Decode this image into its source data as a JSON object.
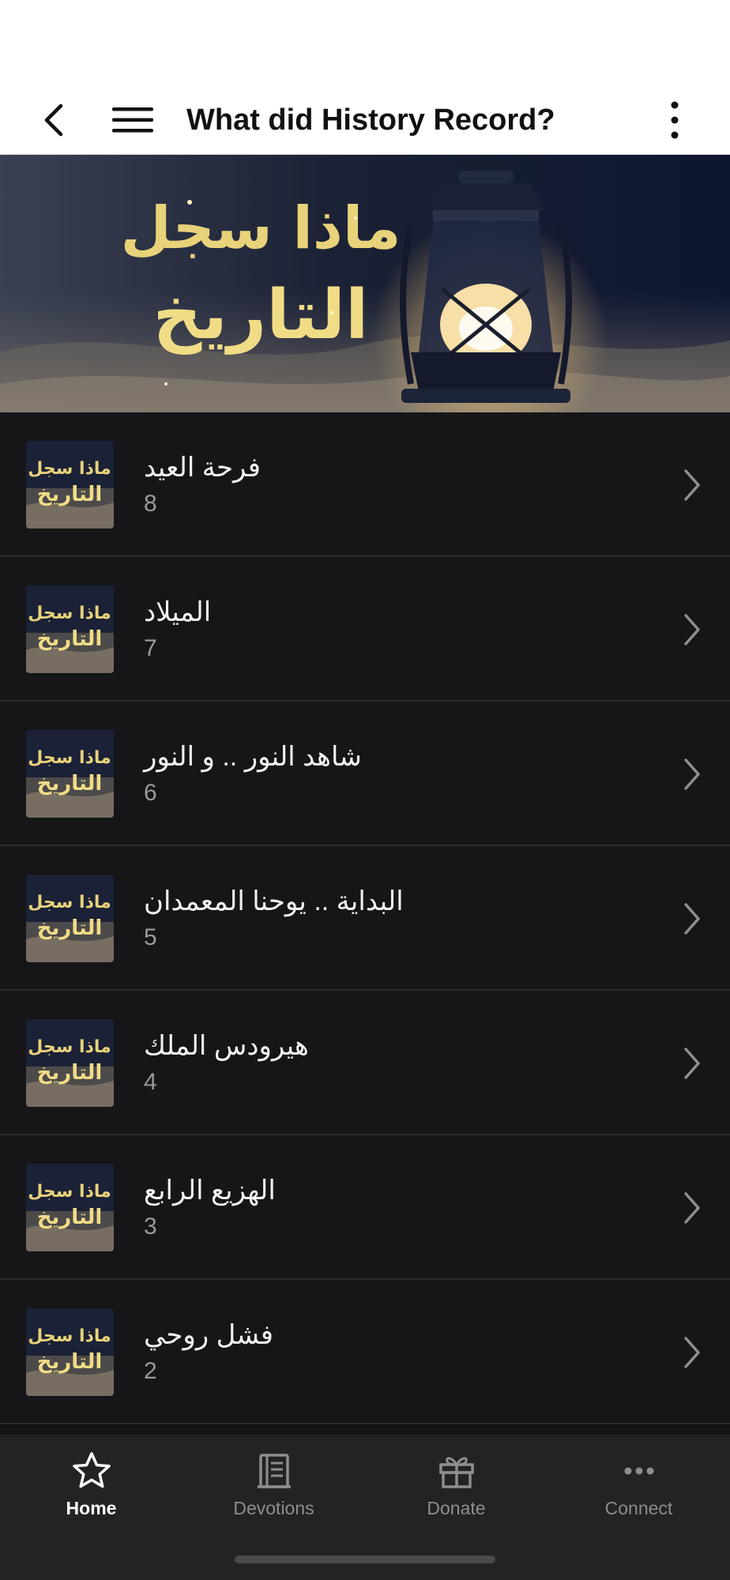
{
  "header": {
    "title": "What did History Record?",
    "back_icon": "chevron-left-icon",
    "menu_icon": "hamburger-menu-icon",
    "more_icon": "more-vertical-icon"
  },
  "banner": {
    "artwork_text": "ماذا سجل التاريخ"
  },
  "episodes": [
    {
      "title": "فرحة العيد",
      "number": "8"
    },
    {
      "title": "الميلاد",
      "number": "7"
    },
    {
      "title": "شاهد النور .. و النور",
      "number": "6"
    },
    {
      "title": "البداية .. يوحنا المعمدان",
      "number": "5"
    },
    {
      "title": "هيرودس الملك",
      "number": "4"
    },
    {
      "title": "الهزيع الرابع",
      "number": "3"
    },
    {
      "title": "فشل روحي",
      "number": "2"
    }
  ],
  "bottom_nav": [
    {
      "label": "Home",
      "icon": "star-icon",
      "active": true
    },
    {
      "label": "Devotions",
      "icon": "book-icon",
      "active": false
    },
    {
      "label": "Donate",
      "icon": "gift-icon",
      "active": false
    },
    {
      "label": "Connect",
      "icon": "more-horizontal-icon",
      "active": false
    }
  ],
  "colors": {
    "background": "#141416",
    "list_item": "#161618",
    "divider": "#2b2b2f",
    "nav_background": "#232326",
    "nav_active": "#ffffff",
    "nav_inactive": "#8d8d92",
    "secondary_text": "#9a9a9e",
    "artwork_gold": "#e8d27a"
  }
}
